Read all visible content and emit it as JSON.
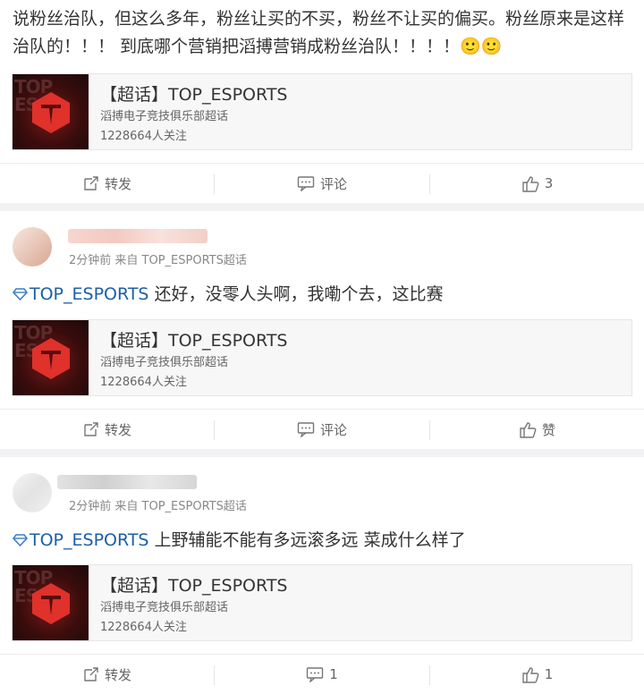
{
  "post1": {
    "text": "说粉丝治队，但这么多年，粉丝让买的不买，粉丝不让买的偏买。粉丝原来是这样治队的！！！ 到底哪个营销把滔搏营销成粉丝治队！！！！",
    "emoji": "🙂🙂",
    "card": {
      "title": "【超话】TOP_ESPORTS",
      "desc": "滔搏电子竞技俱乐部超话",
      "followers": "1228664人关注",
      "watermark": "TOP\nES"
    },
    "actions": {
      "repost": "转发",
      "comment": "评论",
      "like_count": "3"
    }
  },
  "post2": {
    "meta": "2分钟前 来自 TOP_ESPORTS超话",
    "topic": "TOP_ESPORTS",
    "text": " 还好，没零人头啊，我嘞个去，这比赛",
    "card": {
      "title": "【超话】TOP_ESPORTS",
      "desc": "滔搏电子竞技俱乐部超话",
      "followers": "1228664人关注"
    },
    "actions": {
      "repost": "转发",
      "comment": "评论",
      "like": "赞"
    }
  },
  "post3": {
    "meta": "2分钟前 来自 TOP_ESPORTS超话",
    "topic": "TOP_ESPORTS",
    "text": " 上野辅能不能有多远滚多远 菜成什么样了",
    "card": {
      "title": "【超话】TOP_ESPORTS",
      "desc": "滔搏电子竞技俱乐部超话",
      "followers": "1228664人关注"
    },
    "actions": {
      "repost": "转发",
      "comment_count": "1",
      "like_count": "1"
    }
  },
  "colors": {
    "link": "#1c5fa8",
    "logo_red": "#e0312b"
  }
}
